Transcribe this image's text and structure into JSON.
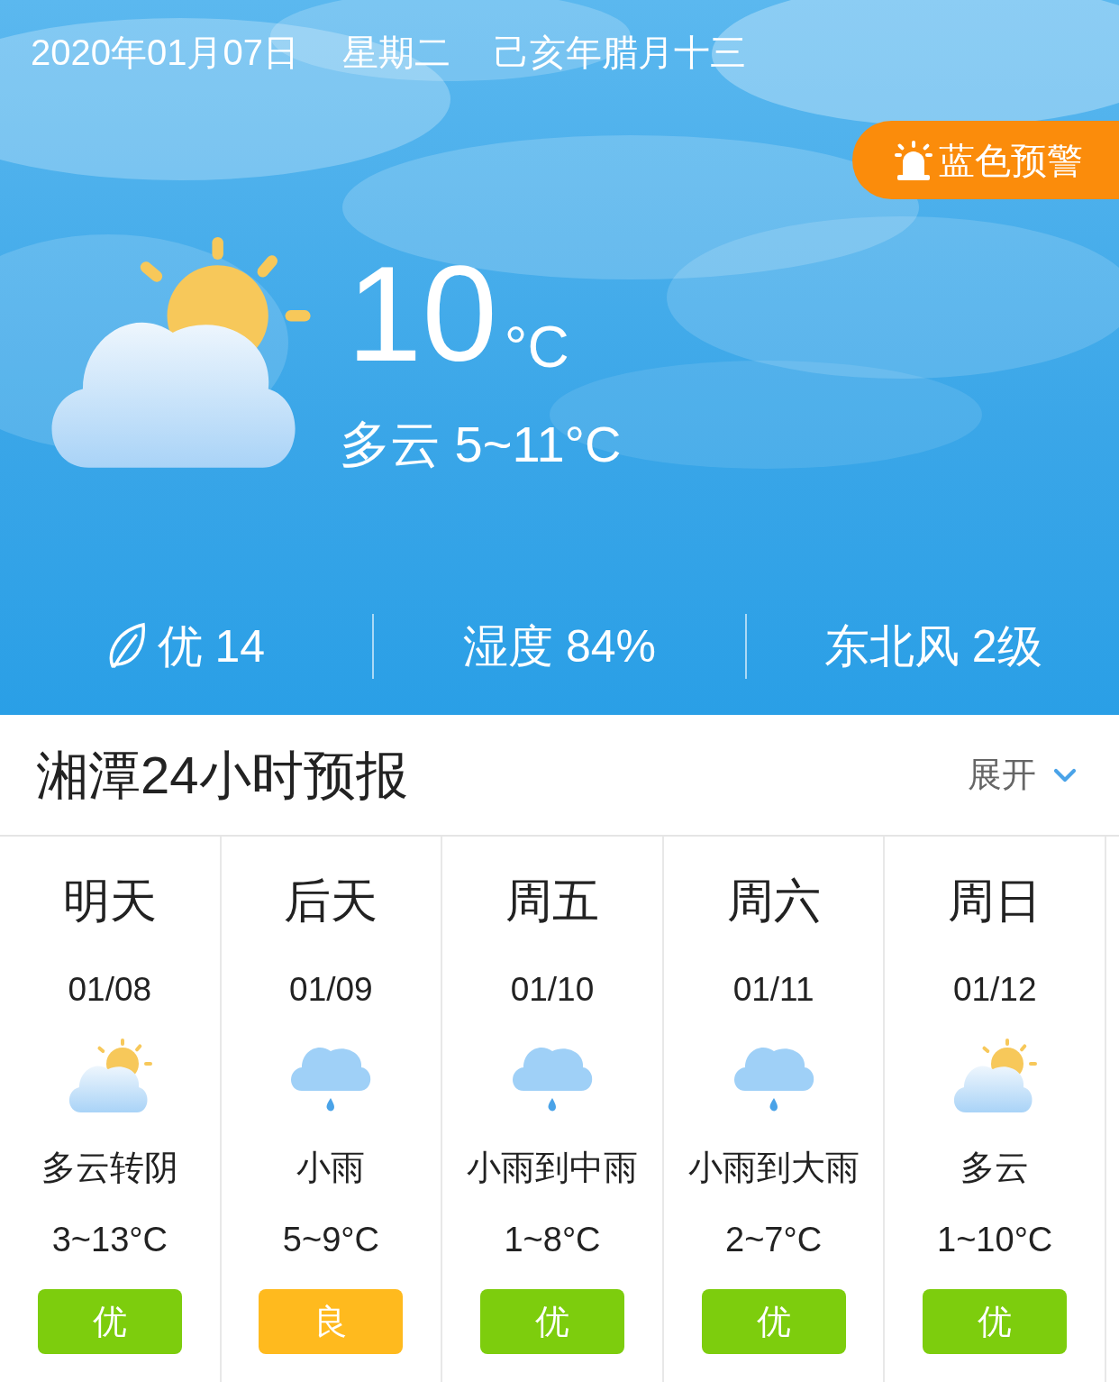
{
  "header": {
    "date": "2020年01月07日",
    "weekday": "星期二",
    "lunar_date": "己亥年腊月十三",
    "alert": "蓝色预警"
  },
  "current": {
    "kind": "partly_cloudy",
    "temperature": "10",
    "unit": "°C",
    "summary": "多云 5~11°C"
  },
  "stats": [
    {
      "kind": "air",
      "text": "优 14"
    },
    {
      "kind": "plain",
      "text": "湿度 84%"
    },
    {
      "kind": "plain",
      "text": "东北风 2级"
    }
  ],
  "forecast": {
    "title": "湘潭24小时预报",
    "expand": "展开",
    "days": [
      {
        "day": "明天",
        "date": "01/08",
        "kind": "partly_cloudy",
        "condition": "多云转阴",
        "temp": "3~13°C",
        "aqi": "优",
        "color": "#7dcd0d"
      },
      {
        "day": "后天",
        "date": "01/09",
        "kind": "rain",
        "condition": "小雨",
        "temp": "5~9°C",
        "aqi": "良",
        "color": "#ffba1e"
      },
      {
        "day": "周五",
        "date": "01/10",
        "kind": "rain",
        "condition": "小雨到中雨",
        "temp": "1~8°C",
        "aqi": "优",
        "color": "#7dcd0d"
      },
      {
        "day": "周六",
        "date": "01/11",
        "kind": "rain",
        "condition": "小雨到大雨",
        "temp": "2~7°C",
        "aqi": "优",
        "color": "#7dcd0d"
      },
      {
        "day": "周日",
        "date": "01/12",
        "kind": "partly_cloudy",
        "condition": "多云",
        "temp": "1~10°C",
        "aqi": "优",
        "color": "#7dcd0d"
      }
    ]
  }
}
